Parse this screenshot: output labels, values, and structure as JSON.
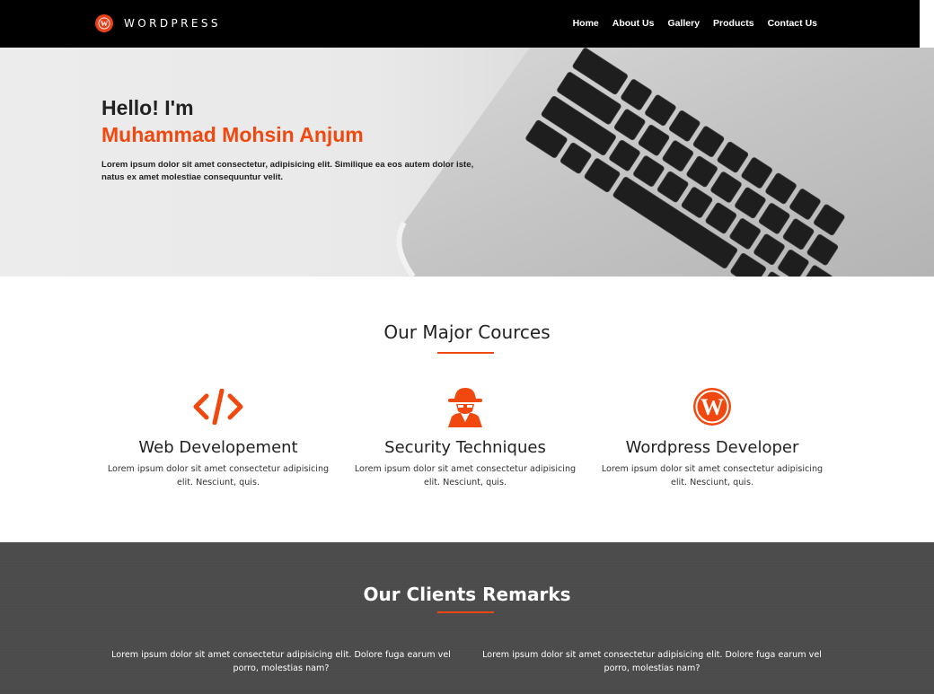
{
  "navbar": {
    "brand": "WORDPRESS",
    "brand_icon": "wordpress-icon",
    "links": [
      "Home",
      "About Us",
      "Gallery",
      "Products",
      "Contact Us"
    ]
  },
  "hero": {
    "greeting": "Hello! I'm",
    "name": "Muhammad Mohsin Anjum",
    "description": "Lorem ipsum dolor sit amet consectetur, adipisicing elit. Similique ea eos autem dolor iste, natus ex amet molestiae consequuntur velit."
  },
  "courses": {
    "title": "Our Major Cources",
    "items": [
      {
        "icon": "code-icon",
        "title": "Web Developement",
        "desc": "Lorem ipsum dolor sit amet consectetur adipisicing elit. Nesciunt, quis."
      },
      {
        "icon": "spy-icon",
        "title": "Security Techniques",
        "desc": "Lorem ipsum dolor sit amet consectetur adipisicing elit. Nesciunt, quis."
      },
      {
        "icon": "wordpress-icon",
        "title": "Wordpress Developer",
        "desc": "Lorem ipsum dolor sit amet consectetur adipisicing elit. Nesciunt, quis."
      }
    ]
  },
  "remarks": {
    "title": "Our Clients Remarks",
    "items": [
      "Lorem ipsum dolor sit amet consectetur adipisicing elit. Dolore fuga earum vel porro, molestias nam?",
      "Lorem ipsum dolor sit amet consectetur adipisicing elit. Dolore fuga earum vel porro, molestias nam?"
    ]
  },
  "colors": {
    "accent": "#f0480f",
    "navbar": "#000000",
    "remarks_bg": "#4b4b4b"
  }
}
